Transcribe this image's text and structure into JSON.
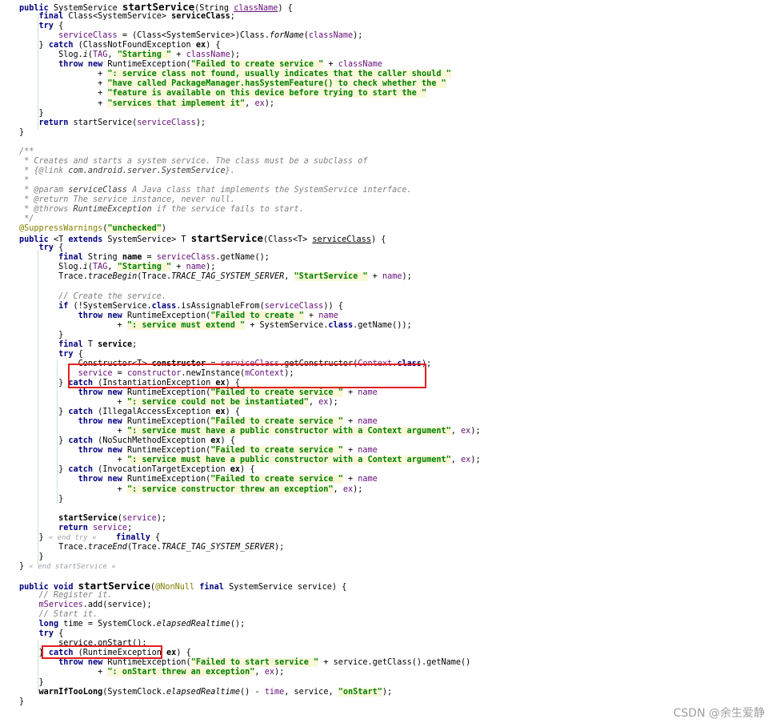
{
  "editor": {
    "lines": [
      [
        [
          "public ",
          "k"
        ],
        [
          "SystemService ",
          ""
        ],
        [
          "startService",
          "m"
        ],
        [
          "(String ",
          ""
        ],
        [
          "className",
          "f u"
        ],
        [
          ") {",
          ""
        ]
      ],
      [
        [
          "    final ",
          "k"
        ],
        [
          "Class<SystemService> ",
          ""
        ],
        [
          "serviceClass",
          "mc"
        ],
        [
          ";",
          ""
        ]
      ],
      [
        [
          "    try ",
          "k"
        ],
        [
          "{",
          ""
        ]
      ],
      [
        [
          "        ",
          ""
        ],
        [
          "serviceClass",
          "f"
        ],
        [
          " = (Class<SystemService>)Class.",
          ""
        ],
        [
          "forName",
          "i"
        ],
        [
          "(",
          ""
        ],
        [
          "className",
          "f"
        ],
        [
          ");",
          ""
        ]
      ],
      [
        [
          "    } ",
          ""
        ],
        [
          "catch ",
          "k"
        ],
        [
          "(ClassNotFoundException ",
          ""
        ],
        [
          "ex",
          "mc"
        ],
        [
          ") {",
          ""
        ]
      ],
      [
        [
          "        Slog.",
          ""
        ],
        [
          "i",
          "i"
        ],
        [
          "(",
          ""
        ],
        [
          "TAG",
          "f"
        ],
        [
          ", ",
          ""
        ],
        [
          "\"Starting \"",
          "s"
        ],
        [
          " + ",
          ""
        ],
        [
          "className",
          "f"
        ],
        [
          ");",
          ""
        ]
      ],
      [
        [
          "        ",
          ""
        ],
        [
          "throw new ",
          "k"
        ],
        [
          "RuntimeException(",
          ""
        ],
        [
          "\"Failed to create service \"",
          "s"
        ],
        [
          " + ",
          ""
        ],
        [
          "className",
          "f"
        ]
      ],
      [
        [
          "                + ",
          ""
        ],
        [
          "\": service class not found, usually indicates that the caller should \"",
          "s"
        ]
      ],
      [
        [
          "                + ",
          ""
        ],
        [
          "\"have called PackageManager.hasSystemFeature() to check whether the \"",
          "s"
        ]
      ],
      [
        [
          "                + ",
          ""
        ],
        [
          "\"feature is available on this device before trying to start the \"",
          "s"
        ]
      ],
      [
        [
          "                + ",
          ""
        ],
        [
          "\"services that implement it\"",
          "s"
        ],
        [
          ", ",
          ""
        ],
        [
          "ex",
          "f"
        ],
        [
          ");",
          ""
        ]
      ],
      [
        [
          "    }",
          ""
        ]
      ],
      [
        [
          "    return ",
          "k"
        ],
        [
          "startService(",
          ""
        ],
        [
          "serviceClass",
          "f"
        ],
        [
          ");",
          ""
        ]
      ],
      [
        [
          "}",
          ""
        ]
      ],
      [
        [
          "",
          ""
        ]
      ],
      [
        [
          "/**",
          "d"
        ]
      ],
      [
        [
          " * Creates and starts a system service. The class must be a subclass of",
          "d"
        ]
      ],
      [
        [
          " * ",
          "d"
        ],
        [
          "{@link ",
          "dt"
        ],
        [
          "com.android.server.SystemService",
          "dl"
        ],
        [
          "}.",
          "d"
        ]
      ],
      [
        [
          " *",
          "d"
        ]
      ],
      [
        [
          " * ",
          "d"
        ],
        [
          "@param ",
          "dt"
        ],
        [
          "serviceClass",
          "dl"
        ],
        [
          " A Java class that implements the SystemService interface.",
          "d"
        ]
      ],
      [
        [
          " * ",
          "d"
        ],
        [
          "@return ",
          "dt"
        ],
        [
          "The service instance, never null.",
          "d"
        ]
      ],
      [
        [
          " * ",
          "d"
        ],
        [
          "@throws ",
          "dt"
        ],
        [
          "RuntimeException",
          "dl"
        ],
        [
          " if the service fails to start.",
          "d"
        ]
      ],
      [
        [
          " */",
          "d"
        ]
      ],
      [
        [
          "@SuppressWarnings",
          "a"
        ],
        [
          "(",
          ""
        ],
        [
          "\"unchecked\"",
          "s"
        ],
        [
          ")",
          ""
        ]
      ],
      [
        [
          "public ",
          "k"
        ],
        [
          "<T ",
          ""
        ],
        [
          "extends ",
          "k"
        ],
        [
          "SystemService> T ",
          ""
        ],
        [
          "startService",
          "m"
        ],
        [
          "(Class<T> ",
          ""
        ],
        [
          "serviceClass",
          "u"
        ],
        [
          ") {",
          ""
        ]
      ],
      [
        [
          "    try ",
          "k"
        ],
        [
          "{",
          ""
        ]
      ],
      [
        [
          "        final ",
          "k"
        ],
        [
          "String ",
          ""
        ],
        [
          "name",
          "mc"
        ],
        [
          " = ",
          ""
        ],
        [
          "serviceClass",
          "f"
        ],
        [
          ".getName();",
          ""
        ]
      ],
      [
        [
          "        Slog.",
          ""
        ],
        [
          "i",
          "i"
        ],
        [
          "(",
          ""
        ],
        [
          "TAG",
          "f"
        ],
        [
          ", ",
          ""
        ],
        [
          "\"Starting \"",
          "s"
        ],
        [
          " + ",
          ""
        ],
        [
          "name",
          "f"
        ],
        [
          ");",
          ""
        ]
      ],
      [
        [
          "        Trace.",
          ""
        ],
        [
          "traceBegin",
          "i"
        ],
        [
          "(Trace.",
          ""
        ],
        [
          "TRACE_TAG_SYSTEM_SERVER",
          "i"
        ],
        [
          ", ",
          ""
        ],
        [
          "\"StartService \"",
          "s"
        ],
        [
          " + ",
          ""
        ],
        [
          "name",
          "f"
        ],
        [
          ");",
          ""
        ]
      ],
      [
        [
          "",
          ""
        ]
      ],
      [
        [
          "        // Create the service.",
          "c"
        ]
      ],
      [
        [
          "        ",
          ""
        ],
        [
          "if ",
          "k"
        ],
        [
          "(!SystemService.",
          ""
        ],
        [
          "class",
          "k"
        ],
        [
          ".isAssignableFrom(",
          ""
        ],
        [
          "serviceClass",
          "f"
        ],
        [
          ")) {",
          ""
        ]
      ],
      [
        [
          "            ",
          ""
        ],
        [
          "throw new ",
          "k"
        ],
        [
          "RuntimeException(",
          ""
        ],
        [
          "\"Failed to create \"",
          "s"
        ],
        [
          " + ",
          ""
        ],
        [
          "name",
          "f"
        ]
      ],
      [
        [
          "                    + ",
          ""
        ],
        [
          "\": service must extend \"",
          "s"
        ],
        [
          " + SystemService.",
          ""
        ],
        [
          "class",
          "k"
        ],
        [
          ".getName());",
          ""
        ]
      ],
      [
        [
          "        }",
          ""
        ]
      ],
      [
        [
          "        ",
          ""
        ],
        [
          "final ",
          "k"
        ],
        [
          "T ",
          ""
        ],
        [
          "service",
          "mc"
        ],
        [
          ";",
          ""
        ]
      ],
      [
        [
          "        ",
          ""
        ],
        [
          "try ",
          "k"
        ],
        [
          "{",
          ""
        ]
      ],
      [
        [
          "            Constructor<T> ",
          ""
        ],
        [
          "constructor",
          "mc"
        ],
        [
          " = ",
          ""
        ],
        [
          "serviceClass",
          "f"
        ],
        [
          ".getConstructor(",
          ""
        ],
        [
          "Context",
          "f"
        ],
        [
          ".",
          ""
        ],
        [
          "class",
          "k"
        ],
        [
          ");",
          ""
        ]
      ],
      [
        [
          "            ",
          ""
        ],
        [
          "service",
          "f"
        ],
        [
          " = ",
          ""
        ],
        [
          "constructor",
          "f"
        ],
        [
          ".newInstance(",
          ""
        ],
        [
          "mContext",
          "f"
        ],
        [
          ");",
          ""
        ]
      ],
      [
        [
          "        } ",
          ""
        ],
        [
          "catch ",
          "k"
        ],
        [
          "(InstantiationException ",
          ""
        ],
        [
          "ex",
          "mc"
        ],
        [
          ") {",
          ""
        ]
      ],
      [
        [
          "            ",
          ""
        ],
        [
          "throw new ",
          "k"
        ],
        [
          "RuntimeException(",
          ""
        ],
        [
          "\"Failed to create service \"",
          "s"
        ],
        [
          " + ",
          ""
        ],
        [
          "name",
          "f"
        ]
      ],
      [
        [
          "                    + ",
          ""
        ],
        [
          "\": service could not be instantiated\"",
          "s"
        ],
        [
          ", ",
          ""
        ],
        [
          "ex",
          "f"
        ],
        [
          ");",
          ""
        ]
      ],
      [
        [
          "        } ",
          ""
        ],
        [
          "catch ",
          "k"
        ],
        [
          "(IllegalAccessException ",
          ""
        ],
        [
          "ex",
          "mc"
        ],
        [
          ") {",
          ""
        ]
      ],
      [
        [
          "            ",
          ""
        ],
        [
          "throw new ",
          "k"
        ],
        [
          "RuntimeException(",
          ""
        ],
        [
          "\"Failed to create service \"",
          "s"
        ],
        [
          " + ",
          ""
        ],
        [
          "name",
          "f"
        ]
      ],
      [
        [
          "                    + ",
          ""
        ],
        [
          "\": service must have a public constructor with a Context argument\"",
          "s"
        ],
        [
          ", ",
          ""
        ],
        [
          "ex",
          "f"
        ],
        [
          ");",
          ""
        ]
      ],
      [
        [
          "        } ",
          ""
        ],
        [
          "catch ",
          "k"
        ],
        [
          "(NoSuchMethodException ",
          ""
        ],
        [
          "ex",
          "mc"
        ],
        [
          ") {",
          ""
        ]
      ],
      [
        [
          "            ",
          ""
        ],
        [
          "throw new ",
          "k"
        ],
        [
          "RuntimeException(",
          ""
        ],
        [
          "\"Failed to create service \"",
          "s"
        ],
        [
          " + ",
          ""
        ],
        [
          "name",
          "f"
        ]
      ],
      [
        [
          "                    + ",
          ""
        ],
        [
          "\": service must have a public constructor with a Context argument\"",
          "s"
        ],
        [
          ", ",
          ""
        ],
        [
          "ex",
          "f"
        ],
        [
          ");",
          ""
        ]
      ],
      [
        [
          "        } ",
          ""
        ],
        [
          "catch ",
          "k"
        ],
        [
          "(InvocationTargetException ",
          ""
        ],
        [
          "ex",
          "mc"
        ],
        [
          ") {",
          ""
        ]
      ],
      [
        [
          "            ",
          ""
        ],
        [
          "throw new ",
          "k"
        ],
        [
          "RuntimeException(",
          ""
        ],
        [
          "\"Failed to create service \"",
          "s"
        ],
        [
          " + ",
          ""
        ],
        [
          "name",
          "f"
        ]
      ],
      [
        [
          "                    + ",
          ""
        ],
        [
          "\": service constructor threw an exception\"",
          "s"
        ],
        [
          ", ",
          ""
        ],
        [
          "ex",
          "f"
        ],
        [
          ");",
          ""
        ]
      ],
      [
        [
          "        }",
          ""
        ]
      ],
      [
        [
          "",
          ""
        ]
      ],
      [
        [
          "        ",
          ""
        ],
        [
          "startService",
          "mc"
        ],
        [
          "(",
          ""
        ],
        [
          "service",
          "f"
        ],
        [
          ");",
          ""
        ]
      ],
      [
        [
          "        ",
          ""
        ],
        [
          "return ",
          "k"
        ],
        [
          "service",
          "f"
        ],
        [
          ";",
          ""
        ]
      ],
      [
        [
          "    } ",
          ""
        ],
        [
          "« end try »",
          "fold"
        ],
        [
          "    ",
          ""
        ],
        [
          "finally ",
          "k"
        ],
        [
          "{",
          ""
        ]
      ],
      [
        [
          "        Trace.",
          ""
        ],
        [
          "traceEnd",
          "i"
        ],
        [
          "(Trace.",
          ""
        ],
        [
          "TRACE_TAG_SYSTEM_SERVER",
          "i"
        ],
        [
          ");",
          ""
        ]
      ],
      [
        [
          "    }",
          ""
        ]
      ],
      [
        [
          "} ",
          ""
        ],
        [
          "« end startService »",
          "fold"
        ]
      ],
      [
        [
          "",
          ""
        ]
      ],
      [
        [
          "public void ",
          "k"
        ],
        [
          "startService",
          "m"
        ],
        [
          "(",
          ""
        ],
        [
          "@NonNull ",
          "a"
        ],
        [
          "final ",
          "k"
        ],
        [
          "SystemService service) {",
          ""
        ]
      ],
      [
        [
          "    // Register it.",
          "c"
        ]
      ],
      [
        [
          "    ",
          ""
        ],
        [
          "mServices",
          "f"
        ],
        [
          ".add(service);",
          ""
        ]
      ],
      [
        [
          "    // Start it.",
          "c"
        ]
      ],
      [
        [
          "    ",
          ""
        ],
        [
          "long ",
          "k"
        ],
        [
          "time",
          ""
        ],
        [
          " = SystemClock.",
          ""
        ],
        [
          "elapsedRealtime",
          "i"
        ],
        [
          "();",
          ""
        ]
      ],
      [
        [
          "    ",
          ""
        ],
        [
          "try ",
          "k"
        ],
        [
          "{",
          ""
        ]
      ],
      [
        [
          "        service.onStart();",
          ""
        ]
      ],
      [
        [
          "    } ",
          ""
        ],
        [
          "catch ",
          "k"
        ],
        [
          "(RuntimeException ",
          ""
        ],
        [
          "ex",
          "mc"
        ],
        [
          ") {",
          ""
        ]
      ],
      [
        [
          "        ",
          ""
        ],
        [
          "throw new ",
          "k"
        ],
        [
          "RuntimeException(",
          ""
        ],
        [
          "\"Failed to start service \"",
          "s"
        ],
        [
          " + service.getClass().getName()",
          ""
        ]
      ],
      [
        [
          "                + ",
          ""
        ],
        [
          "\": onStart threw an exception\"",
          "s"
        ],
        [
          ", ",
          ""
        ],
        [
          "ex",
          "f"
        ],
        [
          ");",
          ""
        ]
      ],
      [
        [
          "    }",
          ""
        ]
      ],
      [
        [
          "    ",
          ""
        ],
        [
          "warnIfTooLong",
          "mc"
        ],
        [
          "(SystemClock.",
          ""
        ],
        [
          "elapsedRealtime",
          "i"
        ],
        [
          "() - ",
          ""
        ],
        [
          "time",
          "f"
        ],
        [
          ", service, ",
          ""
        ],
        [
          "\"onStart\"",
          "s"
        ],
        [
          ");",
          ""
        ]
      ],
      [
        [
          "}",
          ""
        ]
      ]
    ]
  },
  "watermark": "CSDN @余生爱静",
  "colors": {
    "keyword": "#000080",
    "string": "#008000",
    "field": "#660e7a",
    "comment": "#808080",
    "annotation": "#808000",
    "highlight_box": "#e02020"
  }
}
